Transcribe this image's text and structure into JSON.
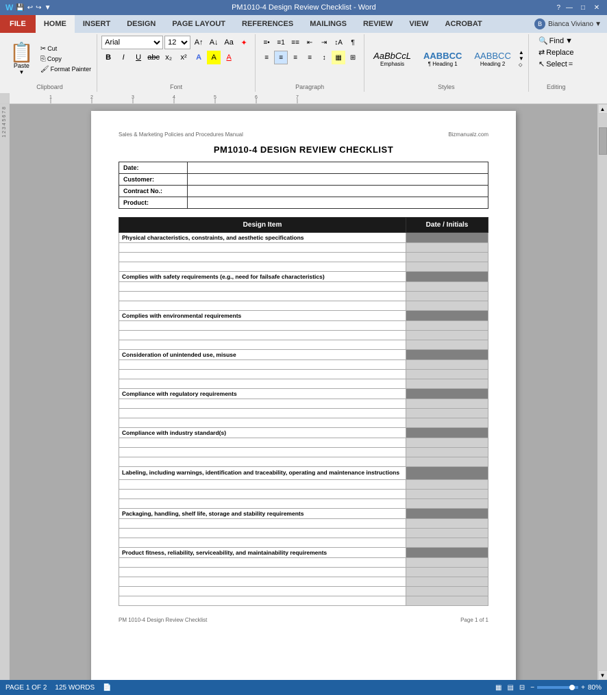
{
  "titleBar": {
    "title": "PM1010-4 Design Review Checklist - Word",
    "appIcons": [
      "⊞",
      "?",
      "—",
      "□",
      "✕"
    ]
  },
  "ribbon": {
    "tabs": [
      "FILE",
      "HOME",
      "INSERT",
      "DESIGN",
      "PAGE LAYOUT",
      "REFERENCES",
      "MAILINGS",
      "REVIEW",
      "VIEW",
      "ACROBAT"
    ],
    "activeTab": "HOME",
    "user": "Bianca Viviano",
    "font": {
      "family": "Arial",
      "size": "12",
      "formatButtons": [
        "B",
        "I",
        "U",
        "abc",
        "x₂",
        "x²"
      ],
      "colorButtons": [
        "A",
        "A",
        "A"
      ]
    },
    "paragraph": {
      "listButtons": [
        "≡",
        "≡",
        "≡",
        "≡"
      ],
      "alignButtons": [
        "≡",
        "≡",
        "≡",
        "≡"
      ],
      "indentButtons": [
        "⇤",
        "⇥"
      ],
      "spacingButtons": [
        "↕"
      ]
    },
    "styles": [
      {
        "label": "Emphasis",
        "preview": "AaBbCcL",
        "italic": true
      },
      {
        "label": "¶ Heading 1",
        "preview": "AABBCC"
      },
      {
        "label": "AABBCC",
        "preview": "AABBCC"
      }
    ],
    "editing": {
      "find": "Find",
      "replace": "Replace",
      "select": "Select"
    }
  },
  "document": {
    "header": {
      "left": "Sales & Marketing Policies and Procedures Manual",
      "right": "Bizmanualz.com"
    },
    "title": "PM1010-4 DESIGN REVIEW CHECKLIST",
    "infoFields": [
      {
        "label": "Date:",
        "value": ""
      },
      {
        "label": "Customer:",
        "value": ""
      },
      {
        "label": "Contract No.:",
        "value": ""
      },
      {
        "label": "Product:",
        "value": ""
      }
    ],
    "tableHeaders": {
      "designItem": "Design Item",
      "dateInitials": "Date / Initials"
    },
    "checklistItems": [
      {
        "text": "Physical characteristics, constraints, and aesthetic specifications",
        "bold": true,
        "dateShade": "dark"
      },
      {
        "text": "",
        "bold": false,
        "dateShade": "light"
      },
      {
        "text": "",
        "bold": false,
        "dateShade": "light"
      },
      {
        "text": "",
        "bold": false,
        "dateShade": "light"
      },
      {
        "text": "Complies with safety requirements (e.g., need for failsafe characteristics)",
        "bold": true,
        "dateShade": "dark"
      },
      {
        "text": "",
        "bold": false,
        "dateShade": "light"
      },
      {
        "text": "",
        "bold": false,
        "dateShade": "light"
      },
      {
        "text": "",
        "bold": false,
        "dateShade": "light"
      },
      {
        "text": "Complies with environmental requirements",
        "bold": true,
        "dateShade": "dark"
      },
      {
        "text": "",
        "bold": false,
        "dateShade": "light"
      },
      {
        "text": "",
        "bold": false,
        "dateShade": "light"
      },
      {
        "text": "",
        "bold": false,
        "dateShade": "light"
      },
      {
        "text": "Consideration of unintended use, misuse",
        "bold": true,
        "dateShade": "dark"
      },
      {
        "text": "",
        "bold": false,
        "dateShade": "light"
      },
      {
        "text": "",
        "bold": false,
        "dateShade": "light"
      },
      {
        "text": "",
        "bold": false,
        "dateShade": "light"
      },
      {
        "text": "Compliance with regulatory requirements",
        "bold": true,
        "dateShade": "dark"
      },
      {
        "text": "",
        "bold": false,
        "dateShade": "light"
      },
      {
        "text": "",
        "bold": false,
        "dateShade": "light"
      },
      {
        "text": "",
        "bold": false,
        "dateShade": "light"
      },
      {
        "text": "Compliance with industry standard(s)",
        "bold": true,
        "dateShade": "dark"
      },
      {
        "text": "",
        "bold": false,
        "dateShade": "light"
      },
      {
        "text": "",
        "bold": false,
        "dateShade": "light"
      },
      {
        "text": "",
        "bold": false,
        "dateShade": "light"
      },
      {
        "text": "Labeling, including warnings, identification and traceability, operating and maintenance instructions",
        "bold": true,
        "dateShade": "dark",
        "multiline": true
      },
      {
        "text": "",
        "bold": false,
        "dateShade": "light"
      },
      {
        "text": "",
        "bold": false,
        "dateShade": "light"
      },
      {
        "text": "",
        "bold": false,
        "dateShade": "light"
      },
      {
        "text": "Packaging, handling, shelf life, storage and stability requirements",
        "bold": true,
        "dateShade": "dark"
      },
      {
        "text": "",
        "bold": false,
        "dateShade": "light"
      },
      {
        "text": "",
        "bold": false,
        "dateShade": "light"
      },
      {
        "text": "",
        "bold": false,
        "dateShade": "light"
      },
      {
        "text": "Product fitness, reliability, serviceability, and maintainability requirements",
        "bold": true,
        "dateShade": "dark"
      },
      {
        "text": "",
        "bold": false,
        "dateShade": "light"
      },
      {
        "text": "",
        "bold": false,
        "dateShade": "light"
      },
      {
        "text": "",
        "bold": false,
        "dateShade": "light"
      },
      {
        "text": "",
        "bold": false,
        "dateShade": "light"
      },
      {
        "text": "",
        "bold": false,
        "dateShade": "light"
      }
    ],
    "footer": {
      "left": "PM 1010-4 Design Review Checklist",
      "right": "Page 1 of 1"
    }
  },
  "statusBar": {
    "pageInfo": "PAGE 1 OF 2",
    "wordCount": "125 WORDS",
    "zoom": "80%",
    "viewButtons": [
      "▦",
      "▤",
      "⊟",
      "⊡"
    ]
  }
}
